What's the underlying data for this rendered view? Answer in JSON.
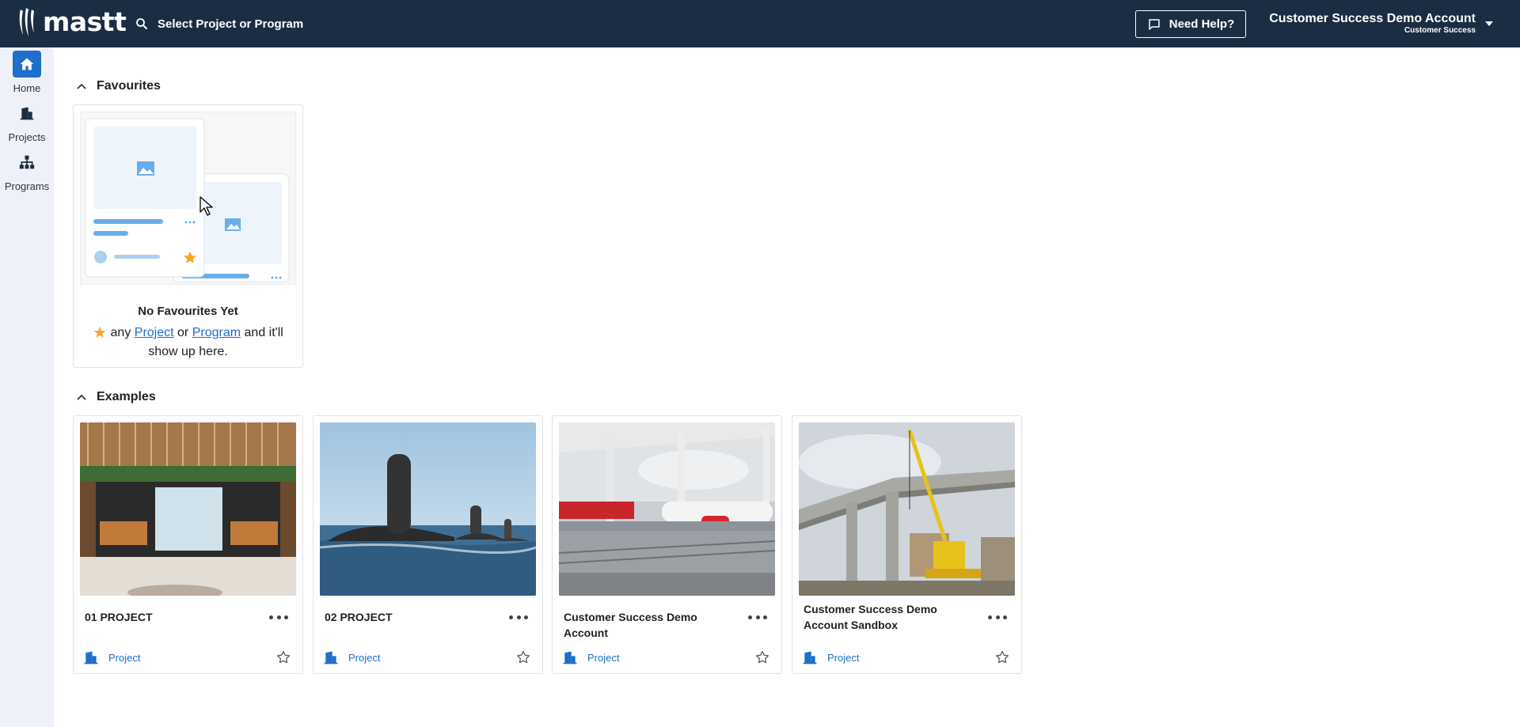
{
  "app": {
    "logo_text": "mastt"
  },
  "header": {
    "search_label": "Select Project or Program",
    "help_label": "Need Help?",
    "account_name": "Customer Success Demo Account",
    "account_sub": "Customer Success"
  },
  "sidebar": {
    "items": [
      {
        "label": "Home",
        "icon": "home-icon",
        "active": true
      },
      {
        "label": "Projects",
        "icon": "building-icon",
        "active": false
      },
      {
        "label": "Programs",
        "icon": "hierarchy-icon",
        "active": false
      }
    ]
  },
  "favourites": {
    "title": "Favourites",
    "empty_title": "No Favourites Yet",
    "desc_any": "any",
    "desc_project_link": "Project",
    "desc_or": "or",
    "desc_program_link": "Program",
    "desc_tail": "and it'll show up here."
  },
  "examples": {
    "title": "Examples",
    "cards": [
      {
        "name": "01 PROJECT",
        "type": "Project",
        "image": "restaurant-interior"
      },
      {
        "name": "02 PROJECT",
        "type": "Project",
        "image": "submarines"
      },
      {
        "name": "Customer Success Demo Account",
        "type": "Project",
        "image": "airport-apron"
      },
      {
        "name": "Customer Success Demo Account Sandbox",
        "type": "Project",
        "image": "bridge-crane"
      }
    ]
  },
  "colors": {
    "topbar": "#1b2d42",
    "accent": "#1e6fc7",
    "sidebar_bg": "#eef2f8",
    "star": "#f5a623"
  }
}
